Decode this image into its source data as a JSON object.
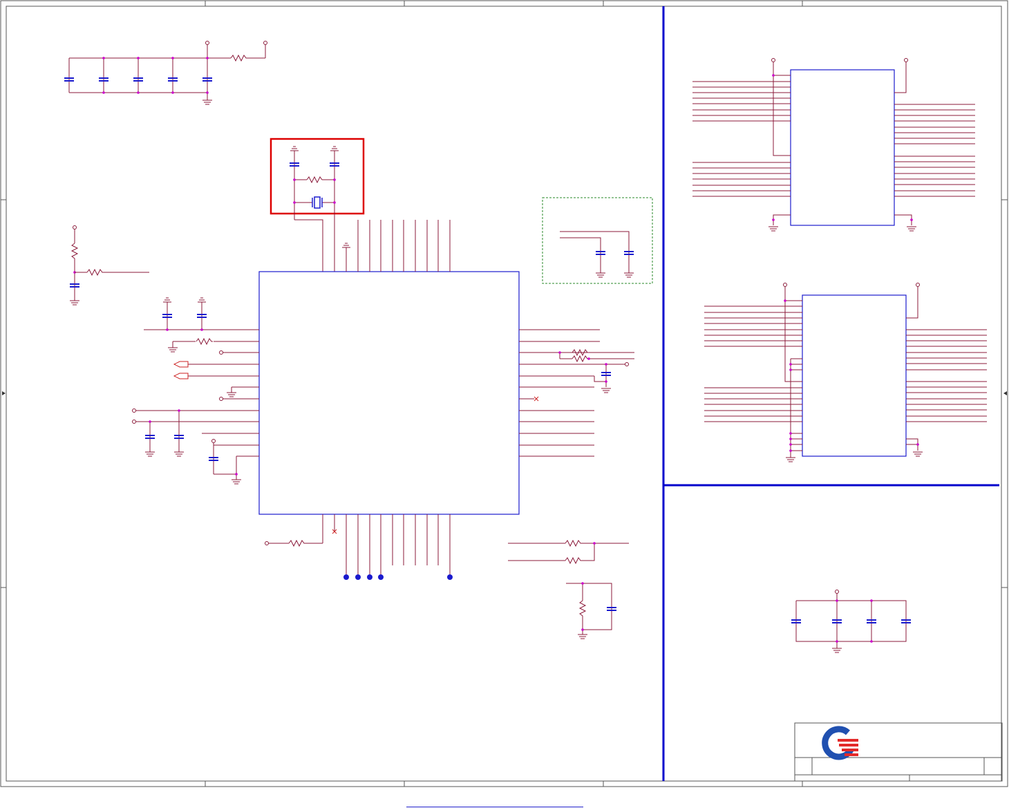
{
  "diagram": {
    "kind": "schematic",
    "colors": {
      "frame": "#555555",
      "wire": "#8b1a3a",
      "component": "#1a1acd",
      "junction": "#cc00cc",
      "divider": "#0000cc",
      "highlight": "#dd0000",
      "optional_box": "#2a8a2a",
      "logo_red": "#e32a2a",
      "logo_blue": "#2050b0"
    },
    "icons": [
      "ground-icon",
      "capacitor-icon",
      "resistor-icon",
      "crystal-icon",
      "power-port-icon",
      "no-connect-icon",
      "company-logo-icon"
    ]
  },
  "footer": {
    "link_text": ""
  }
}
